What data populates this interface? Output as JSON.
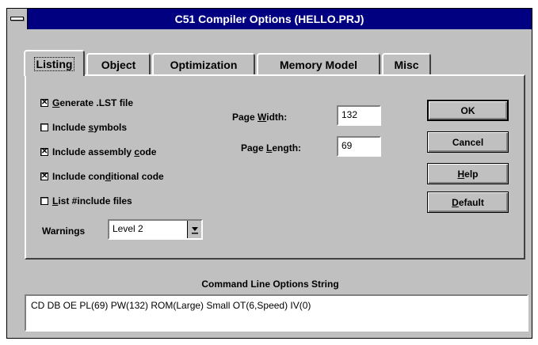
{
  "window": {
    "title": "C51 Compiler Options (HELLO.PRJ)"
  },
  "tabs": [
    {
      "label": "Listing"
    },
    {
      "label": "Object"
    },
    {
      "label": "Optimization"
    },
    {
      "label": "Memory Model"
    },
    {
      "label": "Misc"
    }
  ],
  "listing": {
    "checkboxes": [
      {
        "pre": "",
        "ul": "G",
        "post": "enerate .LST file",
        "checked": true
      },
      {
        "pre": "Include ",
        "ul": "s",
        "post": "ymbols",
        "checked": false
      },
      {
        "pre": "Include assembly ",
        "ul": "c",
        "post": "ode",
        "checked": true
      },
      {
        "pre": "Include con",
        "ul": "d",
        "post": "itional code",
        "checked": true
      },
      {
        "pre": "",
        "ul": "L",
        "post": "ist #include files",
        "checked": false
      }
    ],
    "warnings": {
      "label": "Warnings",
      "value": "Level 2"
    },
    "page_width": {
      "pre": "Page ",
      "ul": "W",
      "post": "idth:",
      "value": "132"
    },
    "page_length": {
      "pre": "Page ",
      "ul": "L",
      "post": "ength:",
      "value": "69"
    }
  },
  "buttons": {
    "ok": "OK",
    "cancel": "Cancel",
    "help": {
      "ul": "H",
      "post": "elp"
    },
    "default": {
      "ul": "D",
      "post": "efault"
    }
  },
  "command_line": {
    "label": "Command Line Options String",
    "value": "CD DB OE PL(69) PW(132) ROM(Large) Small OT(6,Speed) IV(0)"
  },
  "check_mark": "✕"
}
